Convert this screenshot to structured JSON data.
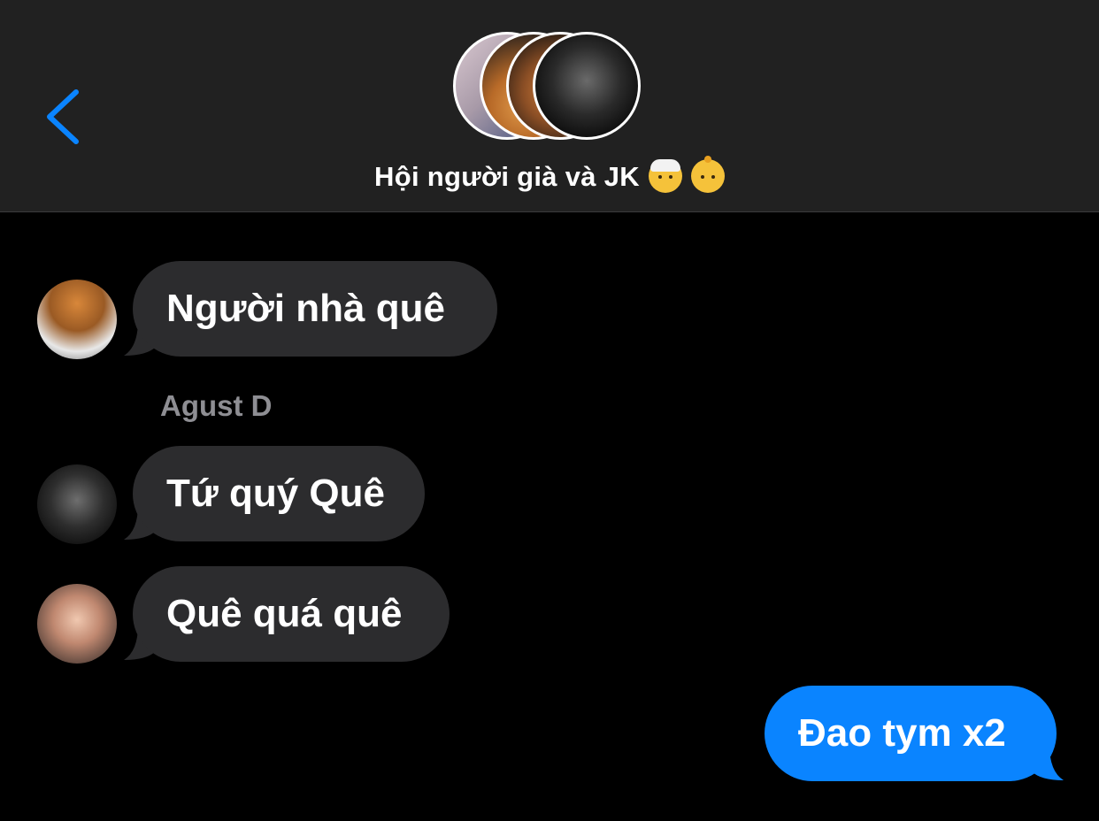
{
  "header": {
    "back_icon": "chevron-left-icon",
    "group_title": "Hội người già và JK",
    "title_emojis": [
      "older-man-emoji",
      "baby-emoji"
    ],
    "accent_color": "#0a84ff"
  },
  "messages": [
    {
      "direction": "incoming",
      "text": "Người nhà quê"
    },
    {
      "sender": "Agust D"
    },
    {
      "direction": "incoming",
      "text": "Tứ quý Quê"
    },
    {
      "direction": "incoming",
      "text": "Quê quá quê"
    },
    {
      "direction": "outgoing",
      "text": "Đao tym x2"
    }
  ],
  "colors": {
    "header_bg": "#212121",
    "chat_bg": "#000000",
    "incoming_bubble": "#2c2c2e",
    "outgoing_bubble": "#0a84ff",
    "sender_name": "#8e8e93"
  }
}
